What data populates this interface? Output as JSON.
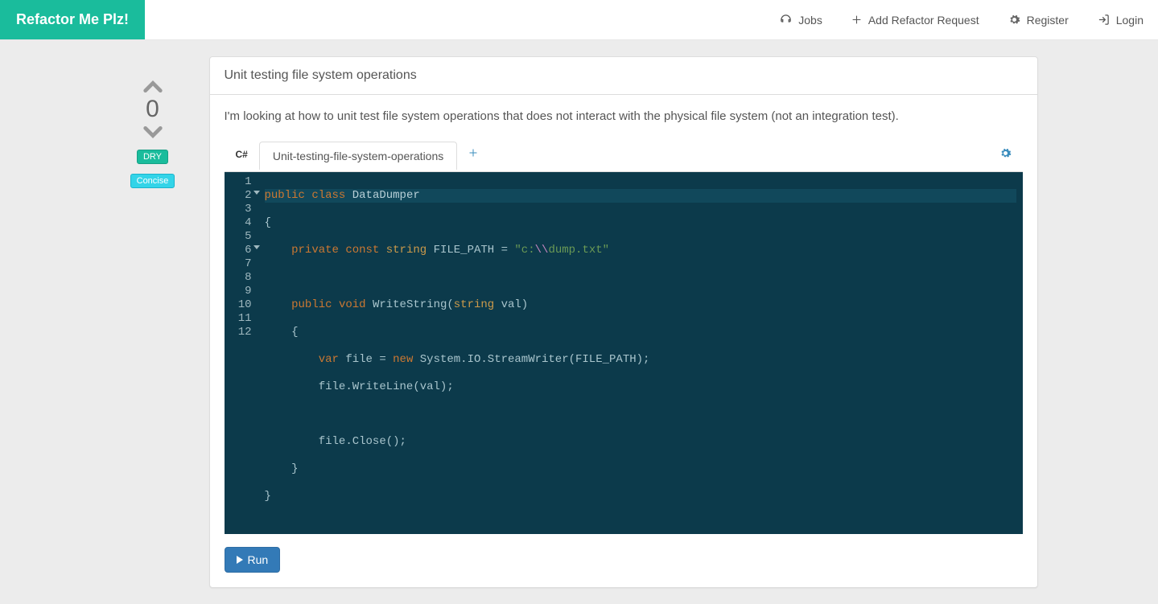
{
  "brand": "Refactor Me Plz!",
  "nav": {
    "jobs": "Jobs",
    "add": "Add Refactor Request",
    "register": "Register",
    "login": "Login"
  },
  "vote": {
    "count": "0"
  },
  "tags": {
    "dry": "DRY",
    "concise": "Concise"
  },
  "post": {
    "title": "Unit testing file system operations",
    "description": "I'm looking at how to unit test file system operations that does not interact with the physical file system (not an integration test)."
  },
  "editor": {
    "lang": "C#",
    "tab": "Unit-testing-file-system-operations",
    "run": "Run",
    "lines": [
      "1",
      "2",
      "3",
      "4",
      "5",
      "6",
      "7",
      "8",
      "9",
      "10",
      "11",
      "12"
    ],
    "code": {
      "l1": {
        "a": "public",
        "b": "class",
        "c": "DataDumper"
      },
      "l2": "{",
      "l3": {
        "a": "private",
        "b": "const",
        "c": "string",
        "d": "FILE_PATH = ",
        "e": "\"c:",
        "f": "\\\\",
        "g": "dump.txt\""
      },
      "l5": {
        "a": "public",
        "b": "void",
        "c": "WriteString(",
        "d": "string",
        "e": " val)"
      },
      "l6": "    {",
      "l7": {
        "a": "var",
        "b": " file = ",
        "c": "new",
        "d": " System.IO.StreamWriter(FILE_PATH);"
      },
      "l8": "        file.WriteLine(val);",
      "l10": "        file.Close();",
      "l11": "    }",
      "l12": "}"
    }
  }
}
